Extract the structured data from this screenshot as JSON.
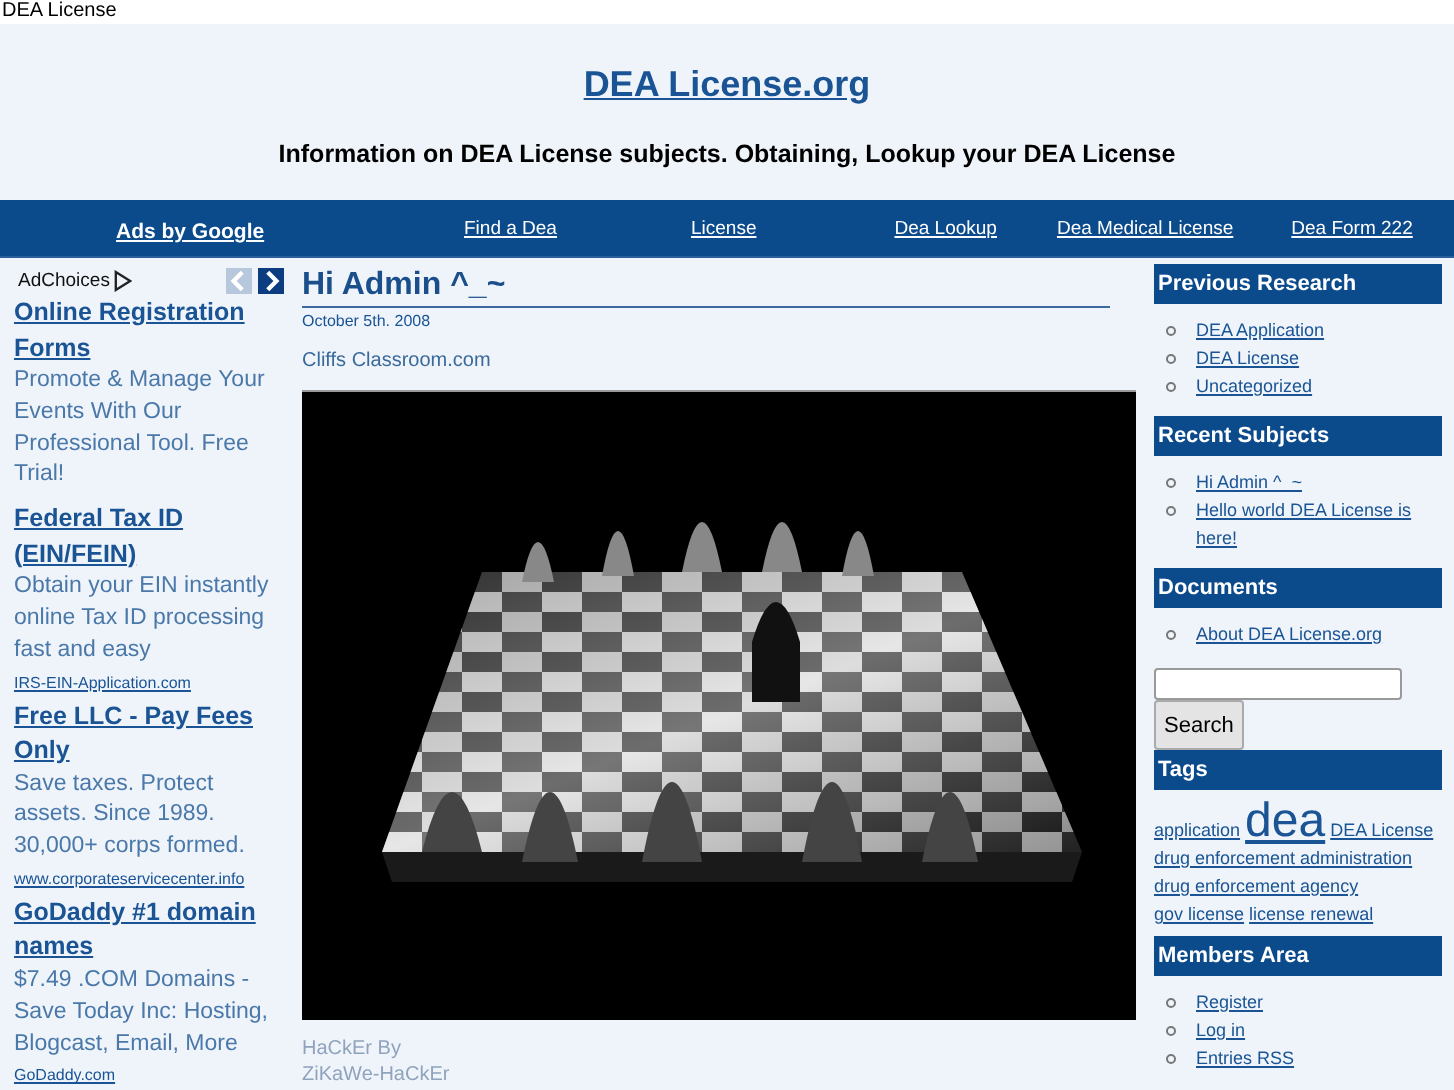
{
  "page_title": "DEA License",
  "header": {
    "site_title": "DEA License.org",
    "tagline": "Information on DEA License subjects. Obtaining, Lookup your DEA License"
  },
  "nav": [
    {
      "label": "Ads by Google",
      "kind": "ads"
    },
    {
      "label": "Find a Dea",
      "kind": "link"
    },
    {
      "label": "License",
      "kind": "link"
    },
    {
      "label": "Dea Lookup",
      "kind": "link"
    },
    {
      "label": "Dea Medical License",
      "kind": "link"
    },
    {
      "label": "Dea Form 222",
      "kind": "link"
    }
  ],
  "ads": {
    "label": "AdChoices",
    "prev_disabled": true,
    "next_disabled": false,
    "items": [
      {
        "title": "Online Registration Forms",
        "text": "Promote & Manage Your Events With Our Professional Tool. Free Trial!"
      },
      {
        "title": "Federal Tax ID (EIN/FEIN)",
        "text": "Obtain your EIN instantly online Tax ID processing fast and easy",
        "url": "IRS-EIN-Application.com"
      },
      {
        "title": "Free LLC - Pay Fees Only",
        "text": "Save taxes. Protect assets. Since 1989. 30,000+ corps formed.",
        "url": "www.corporateservicecenter.info"
      },
      {
        "title": "GoDaddy #1 domain names",
        "text": "$7.49 .COM Domains - Save Today Inc: Hosting, Blogcast, Email, More",
        "url": "GoDaddy.com"
      }
    ]
  },
  "post": {
    "title": "Hi Admin ^_~",
    "date": "October 5th. 2008",
    "source": "Cliffs Classroom.com",
    "caption": "HaCkEr By ZiKaWe-HaCkEr"
  },
  "sidebar": [
    {
      "kind": "list",
      "title": "Previous Research",
      "items": [
        "DEA Application",
        "DEA License",
        "Uncategorized"
      ]
    },
    {
      "kind": "list",
      "title": "Recent Subjects",
      "items": [
        "Hi Admin ^_~",
        "Hello world DEA License is here!"
      ]
    },
    {
      "kind": "list",
      "title": "Documents",
      "items": [
        "About DEA License.org"
      ]
    },
    {
      "kind": "search",
      "button": "Search"
    },
    {
      "kind": "tags",
      "title": "Tags",
      "tags": [
        {
          "label": "application",
          "kind": "small"
        },
        {
          "label": "dea",
          "kind": "large"
        },
        {
          "label": "DEA License",
          "kind": "small"
        },
        {
          "label": "drug enforcement administration",
          "kind": "small"
        },
        {
          "label": "drug enforcement agency",
          "kind": "small"
        },
        {
          "label": "gov license",
          "kind": "small"
        },
        {
          "label": "license renewal",
          "kind": "small"
        }
      ]
    },
    {
      "kind": "list",
      "title": "Members Area",
      "items": [
        "Register",
        "Log in",
        "Entries RSS"
      ]
    }
  ]
}
